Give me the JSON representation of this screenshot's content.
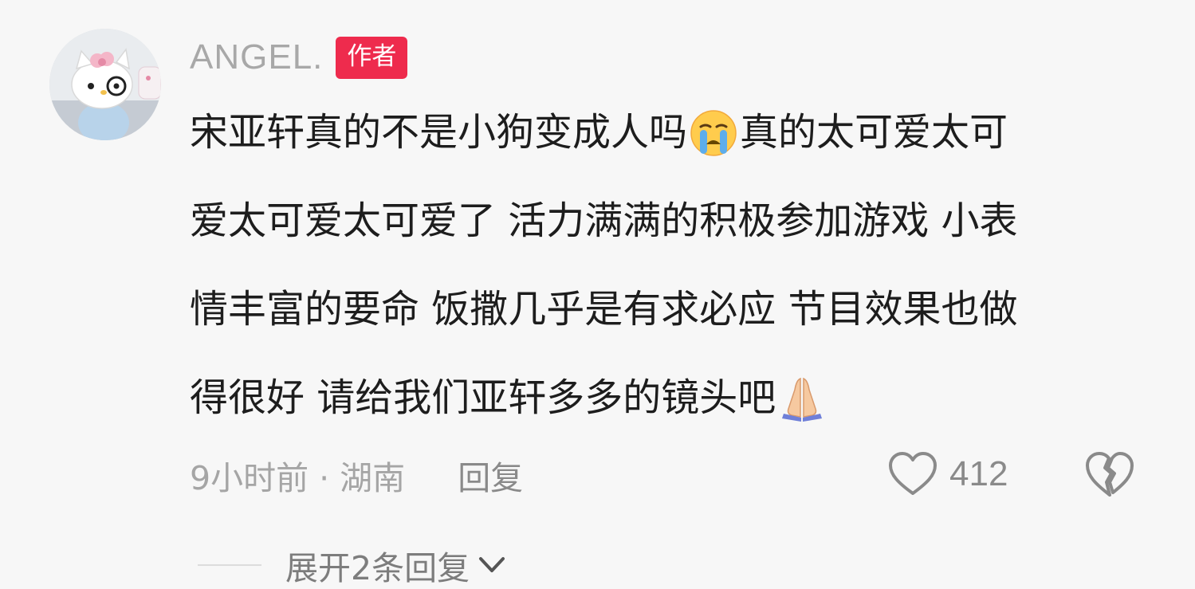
{
  "comment": {
    "author": {
      "username": "ANGEL.",
      "badge": "作者"
    },
    "lines": [
      {
        "parts": [
          {
            "text": "宋亚轩真的不是小狗变成人吗"
          },
          {
            "emoji": "crying-face-icon"
          },
          {
            "text": "真的太可爱太可"
          }
        ]
      },
      {
        "parts": [
          {
            "text": "爱太可爱太可爱了 活力满满的积极参加游戏 小表"
          }
        ]
      },
      {
        "parts": [
          {
            "text": "情丰富的要命 饭撒几乎是有求必应 节目效果也做"
          }
        ]
      },
      {
        "parts": [
          {
            "text": "得很好 请给我们亚轩多多的镜头吧"
          },
          {
            "emoji": "folded-hands-icon"
          }
        ]
      }
    ],
    "meta": {
      "time_location": "9小时前 · 湖南",
      "reply_label": "回复"
    },
    "likes": {
      "count": "412",
      "icon": "heart-outline-icon"
    },
    "dislike": {
      "icon": "broken-heart-icon"
    },
    "expand_replies": {
      "label": "展开2条回复",
      "icon": "chevron-down-icon"
    }
  },
  "colors": {
    "background": "#f7f7f7",
    "badge": "#ee2b4d",
    "text_primary": "#1d1d1d",
    "text_secondary": "#a5a5a5"
  }
}
